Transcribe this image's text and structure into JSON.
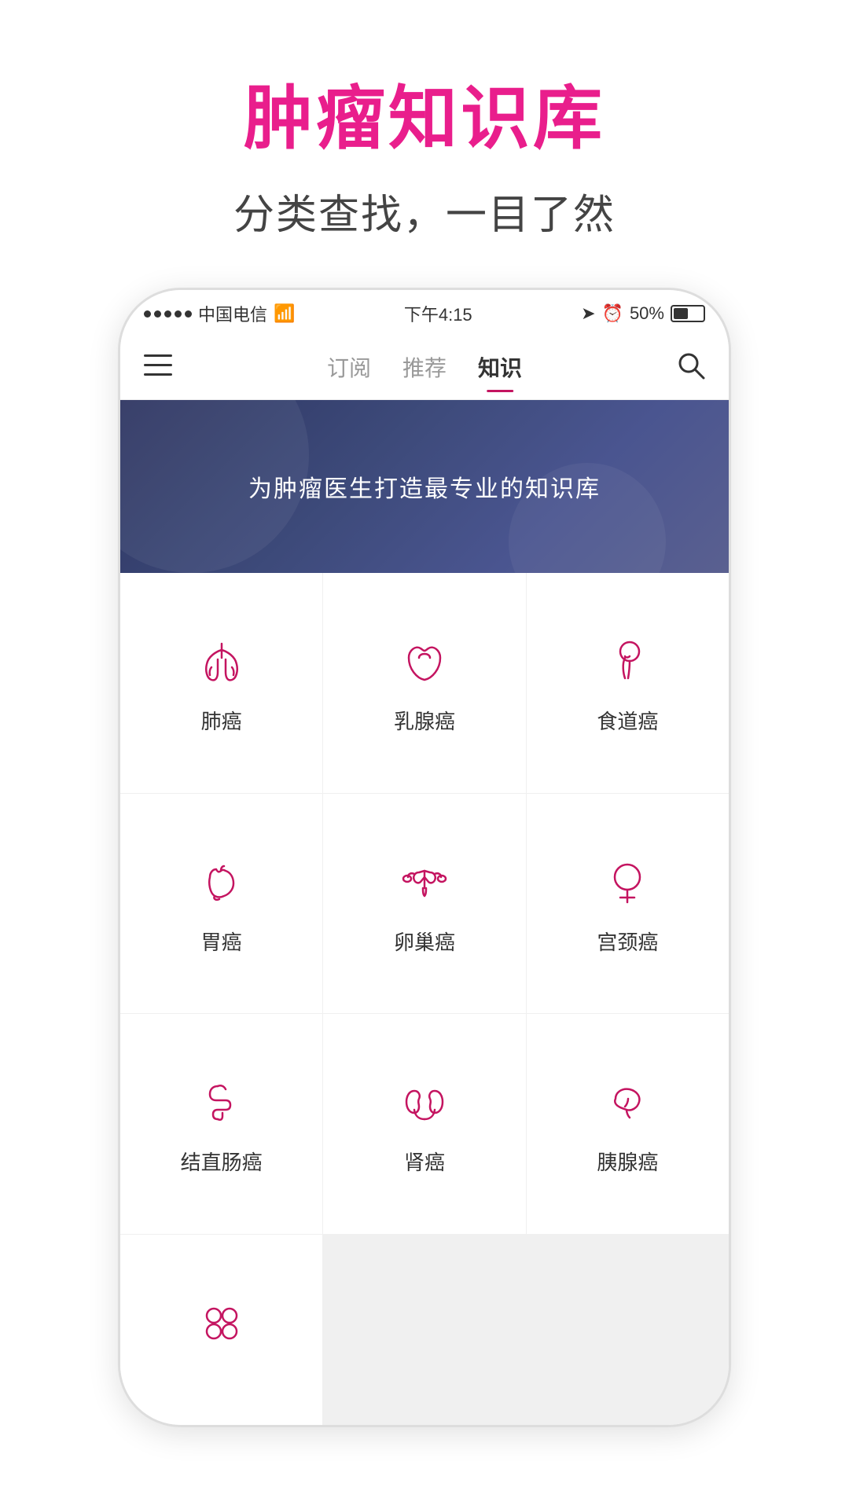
{
  "page": {
    "title": "肿瘤知识库",
    "subtitle": "分类查找，一目了然"
  },
  "statusBar": {
    "carrier": "中国电信",
    "time": "下午4:15",
    "battery": "50%"
  },
  "navBar": {
    "tabs": [
      {
        "label": "订阅",
        "active": false
      },
      {
        "label": "推荐",
        "active": false
      },
      {
        "label": "知识",
        "active": true
      }
    ]
  },
  "banner": {
    "text": "为肿瘤医生打造最专业的知识库"
  },
  "categories": [
    {
      "id": "lung",
      "label": "肺癌",
      "icon": "lung"
    },
    {
      "id": "breast",
      "label": "乳腺癌",
      "icon": "breast"
    },
    {
      "id": "esophagus",
      "label": "食道癌",
      "icon": "esophagus"
    },
    {
      "id": "stomach",
      "label": "胃癌",
      "icon": "stomach"
    },
    {
      "id": "ovary",
      "label": "卵巢癌",
      "icon": "ovary"
    },
    {
      "id": "cervix",
      "label": "宫颈癌",
      "icon": "cervix"
    },
    {
      "id": "colorectal",
      "label": "结直肠癌",
      "icon": "colorectal"
    },
    {
      "id": "kidney",
      "label": "肾癌",
      "icon": "kidney"
    },
    {
      "id": "pancreas",
      "label": "胰腺癌",
      "icon": "pancreas"
    },
    {
      "id": "more",
      "label": "",
      "icon": "more"
    }
  ]
}
